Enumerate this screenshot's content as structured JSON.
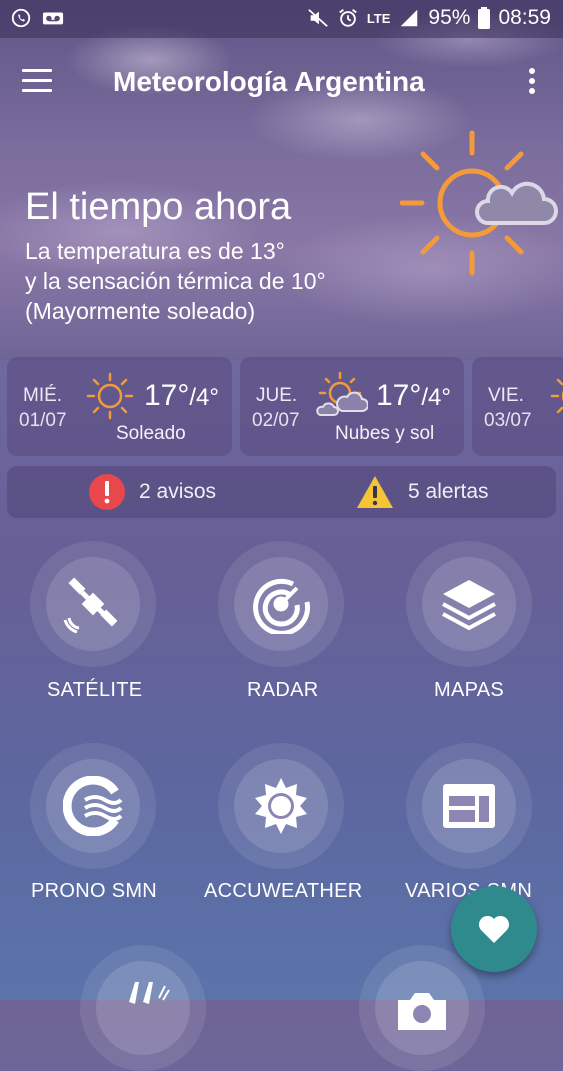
{
  "status_bar": {
    "battery": "95%",
    "time": "08:59",
    "network": "LTE",
    "icons": [
      "whatsapp-icon",
      "voicemail-icon",
      "mute-icon",
      "alarm-icon",
      "signal-icon",
      "battery-icon"
    ]
  },
  "app_bar": {
    "title": "Meteorología Argentina",
    "menu_icon": "hamburger-menu-icon",
    "more_icon": "more-vert-icon"
  },
  "current": {
    "heading": "El tiempo ahora",
    "line1": "La temperatura es de 13°",
    "line2": "y la sensación térmica de 10°",
    "line3": "(Mayormente soleado)",
    "icon": "sun-cloud-icon"
  },
  "forecast": [
    {
      "day": "MIÉ.",
      "date": "01/07",
      "high": "17°",
      "low": "/4°",
      "desc": "Soleado",
      "icon": "sun-icon"
    },
    {
      "day": "JUE.",
      "date": "02/07",
      "high": "17°",
      "low": "/4°",
      "desc": "Nubes y sol",
      "icon": "partly-cloudy-icon"
    },
    {
      "day": "VIE.",
      "date": "03/07",
      "icon": "sun-icon"
    }
  ],
  "alerts": {
    "avisos": "2 avisos",
    "alertas": "5 alertas",
    "colors": {
      "avisos": "#e8474c",
      "alertas": "#f3c534"
    }
  },
  "tiles": [
    {
      "label": "SATÉLITE",
      "icon": "satellite-icon"
    },
    {
      "label": "RADAR",
      "icon": "radar-icon"
    },
    {
      "label": "MAPAS",
      "icon": "layers-icon"
    },
    {
      "label": "PRONO SMN",
      "icon": "smn-logo-icon"
    },
    {
      "label": "ACCUWEATHER",
      "icon": "sun-badge-icon"
    },
    {
      "label": "VARIOS SMN",
      "icon": "dashboard-icon"
    }
  ],
  "partial_tiles": [
    {
      "icon": "feather-icon"
    },
    {
      "icon": "camera-icon"
    }
  ],
  "fab": {
    "icon": "heart-icon",
    "color": "#2e8a8c"
  },
  "accent": {
    "sun_orange": "#f39a3a"
  }
}
